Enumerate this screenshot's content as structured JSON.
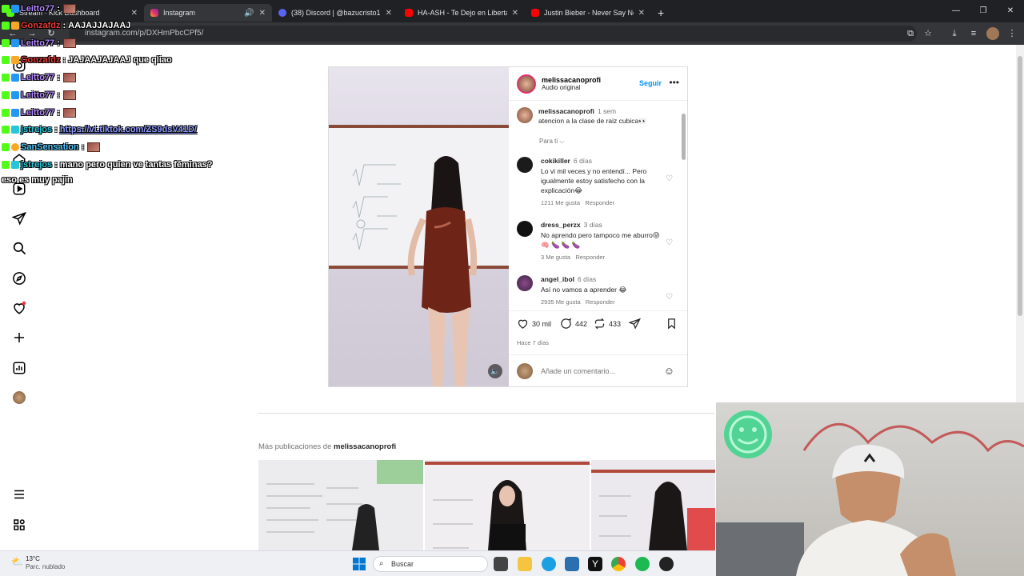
{
  "browser": {
    "tabs": [
      {
        "title": "Stream · Kick Dashboard",
        "color": "#53fc18"
      },
      {
        "title": "Instagram",
        "color": "#e1306c",
        "active": true
      },
      {
        "title": "(38) Discord | @bazucristo1",
        "color": "#5865f2"
      },
      {
        "title": "HA-ASH - Te Dejo en Libertad (",
        "color": "#ff0000"
      },
      {
        "title": "Justin Bieber - Never Say Never",
        "color": "#ff0000"
      }
    ],
    "new_tab": "+",
    "url": "instagram.com/p/DXHmPbcCPf5/",
    "window_controls": [
      "—",
      "❐",
      "✕"
    ]
  },
  "post": {
    "author": "melissacanoprofi",
    "audio": "Audio original",
    "follow_label": "Seguir",
    "caption": {
      "user": "melissacanoprofi",
      "time": "1 sem",
      "text": "atencion a la clase de raiz cubica👀"
    },
    "for_you": "Para ti ⌵",
    "comments": [
      {
        "user": "cokikiller",
        "time": "6 días",
        "text": "Lo vi mil veces y no entendí... Pero igualmente estoy satisfecho con la explicación😂",
        "likes": "1211 Me gusta",
        "reply": "Responder"
      },
      {
        "user": "dress_perzx",
        "time": "3 días",
        "text": "No aprendo pero tampoco me aburro😝 🧠 🍆 🍆 🍆",
        "likes": "3 Me gusta",
        "reply": "Responder"
      },
      {
        "user": "angel_ibol",
        "time": "6 días",
        "text": "Así no vamos a aprender 😂",
        "likes": "2935 Me gusta",
        "reply": "Responder"
      }
    ],
    "likes_count": "30 mil",
    "comments_count": "442",
    "reposts_count": "433",
    "posted_ago": "Hace 7 días",
    "add_comment_placeholder": "Añade un comentario..."
  },
  "more_posts": {
    "prefix": "Más publicaciones de ",
    "user": "melissacanoprofi"
  },
  "chat": [
    {
      "user": "Leitto77",
      "sep": " :",
      "color": "#b388ff",
      "msg": "",
      "emote": true
    },
    {
      "user": "Gonzafdz",
      "sep": " :",
      "color": "#e53935",
      "msg": "AAJAJJAJAAJ",
      "emote": false
    },
    {
      "user": "Leitto77",
      "sep": " :",
      "color": "#b388ff",
      "msg": "",
      "emote": true
    },
    {
      "user": "Gonzafdz",
      "sep": " :",
      "color": "#e53935",
      "msg": "JAJAAJAJAAJ que qliao",
      "emote": false
    },
    {
      "user": "Leitto77",
      "sep": " :",
      "color": "#b388ff",
      "msg": "",
      "emote": true
    },
    {
      "user": "Leitto77",
      "sep": " :",
      "color": "#b388ff",
      "msg": "",
      "emote": true
    },
    {
      "user": "Leitto77",
      "sep": " :",
      "color": "#b388ff",
      "msg": "",
      "emote": true
    },
    {
      "user": "jstrejos",
      "sep": " :",
      "color": "#26c6da",
      "msg": "",
      "link": "https://vt.tiktok.com/ZS9dsV41D/",
      "emote": false
    },
    {
      "user": "SanSensation",
      "sep": " :",
      "color": "#4fc3f7",
      "msg": "",
      "emote": true
    },
    {
      "user": "jstrejos",
      "sep": " :",
      "color": "#26c6da",
      "msg": "mano pero quien ve tantas féminas?",
      "emote": false
    }
  ],
  "chat_wrap": "eso es muy pajín",
  "taskbar": {
    "temp": "13°C",
    "condition": "Parc. nublado",
    "search": "Buscar"
  },
  "colors": {
    "ig_blue": "#0095f6",
    "chrome_dark": "#202124",
    "chrome_bar": "#35363a"
  }
}
